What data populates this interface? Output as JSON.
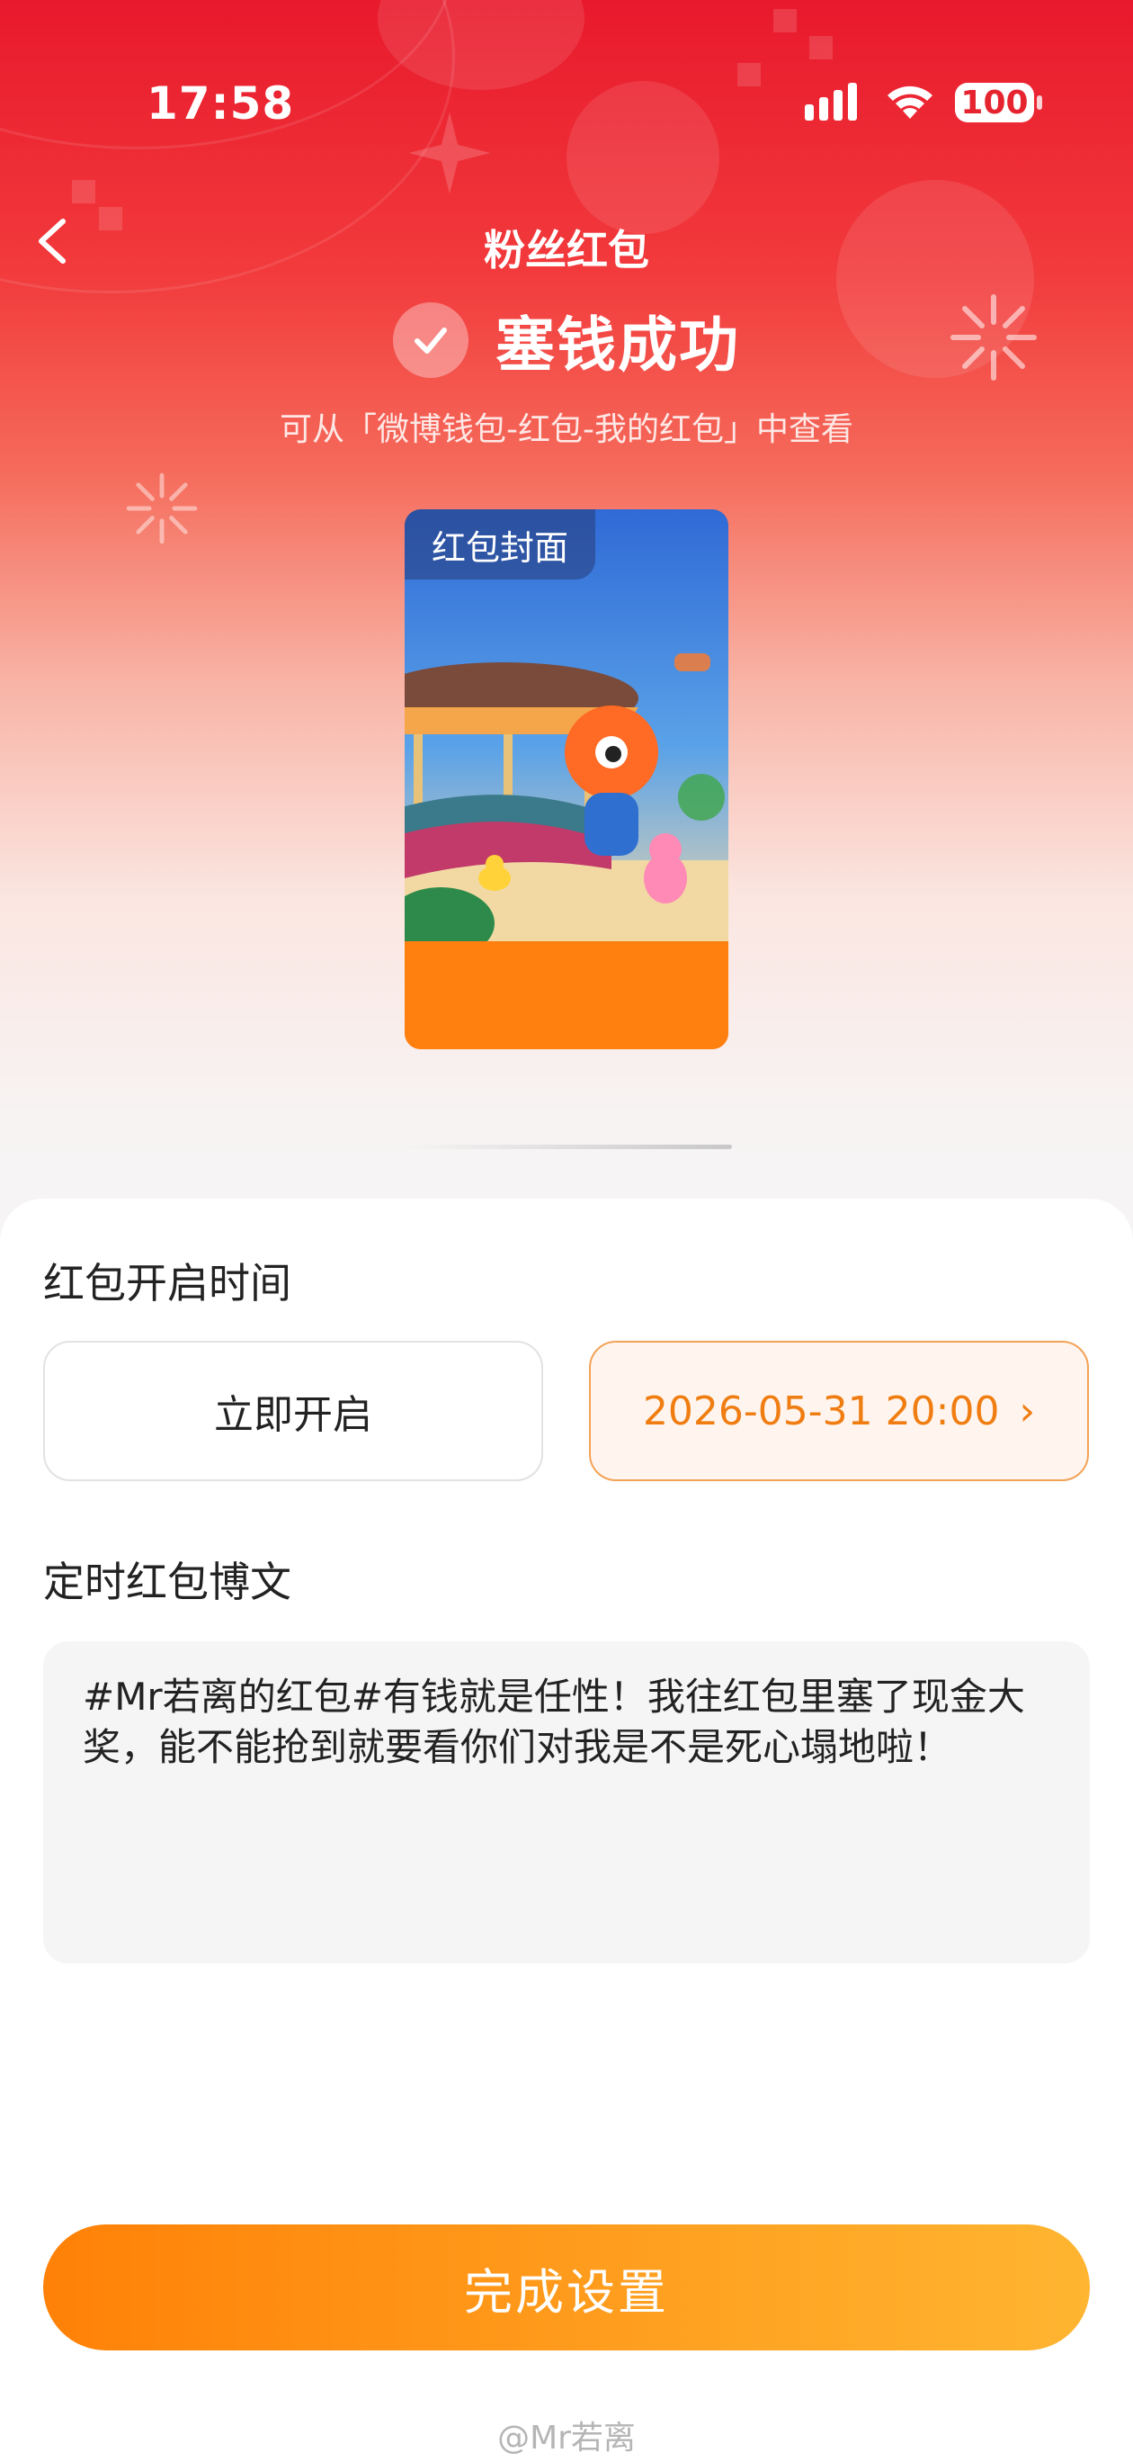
{
  "status_bar": {
    "time": "17:58",
    "battery": "100"
  },
  "nav": {
    "title": "粉丝红包"
  },
  "result": {
    "title": "塞钱成功",
    "hint": "可从「微博钱包-红包-我的红包」中查看"
  },
  "cover": {
    "badge": "红包封面"
  },
  "open_time": {
    "label": "红包开启时间",
    "option_now": "立即开启",
    "option_scheduled": "2026-05-31 20:00",
    "selected": "option_scheduled"
  },
  "post": {
    "label": "定时红包博文",
    "text": "#Mr若离的红包#有钱就是任性！我往红包里塞了现金大奖，能不能抢到就要看你们对我是不是死心塌地啦！"
  },
  "footer": {
    "done_button": "完成设置",
    "watermark": "@Mr若离"
  },
  "colors": {
    "accent": "#ff8107",
    "hero_red": "#e8192c",
    "selected_text": "#f07d12"
  }
}
